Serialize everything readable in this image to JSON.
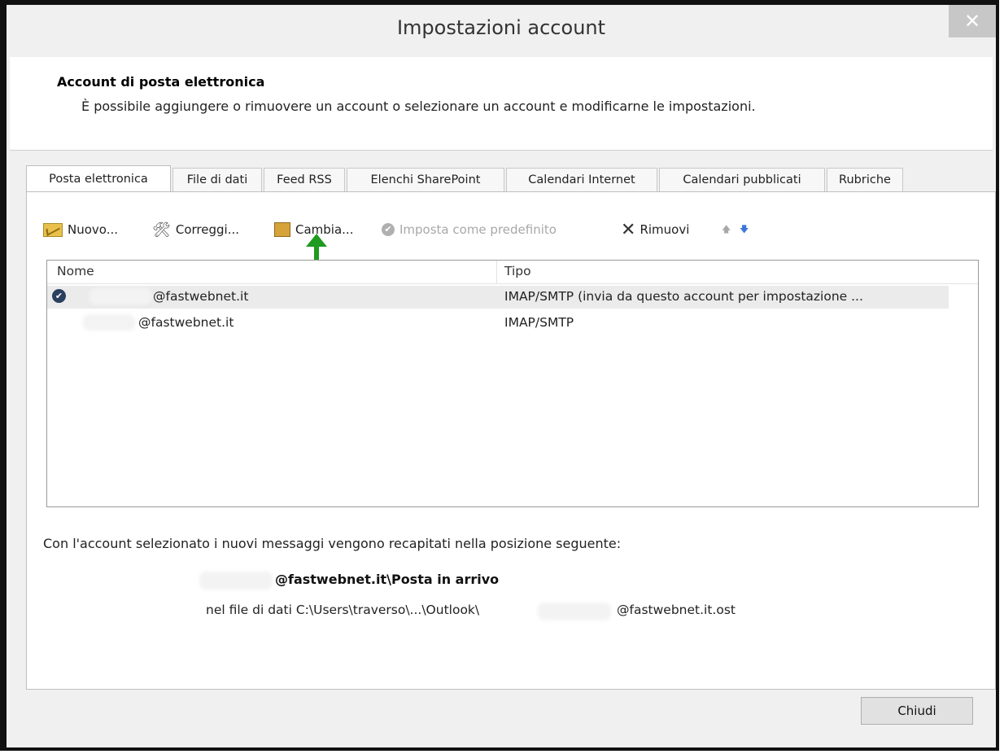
{
  "window": {
    "title": "Impostazioni account",
    "close_glyph": "✕"
  },
  "header": {
    "title": "Account di posta elettronica",
    "description": "È possibile aggiungere o rimuovere un account o selezionare un account e modificarne le impostazioni."
  },
  "tabs": [
    {
      "label": "Posta elettronica",
      "active": true
    },
    {
      "label": "File di dati"
    },
    {
      "label": "Feed RSS"
    },
    {
      "label": "Elenchi SharePoint"
    },
    {
      "label": "Calendari Internet"
    },
    {
      "label": "Calendari pubblicati"
    },
    {
      "label": "Rubriche"
    }
  ],
  "toolbar": {
    "new_label": "Nuovo...",
    "repair_label": "Correggi...",
    "change_label": "Cambia...",
    "set_default_label": "Imposta come predefinito",
    "remove_label": "Rimuovi",
    "up_glyph": "🡅",
    "down_glyph": "🡇"
  },
  "accounts": {
    "columns": {
      "name": "Nome",
      "type": "Tipo"
    },
    "rows": [
      {
        "name": "@fastwebnet.it",
        "type": "IMAP/SMTP (invia da questo account per impostazione ...",
        "default": true
      },
      {
        "name": "@fastwebnet.it",
        "type": "IMAP/SMTP",
        "default": false
      }
    ]
  },
  "delivery": {
    "info": "Con l'account selezionato i nuovi messaggi vengono recapitati nella posizione seguente:",
    "mailbox": "@fastwebnet.it\\Posta in arrivo",
    "file_prefix": "nel file di dati C:\\Users\\traverso\\...\\Outlook\\",
    "file_suffix": "@fastwebnet.it.ost"
  },
  "footer": {
    "close_label": "Chiudi"
  },
  "colors": {
    "annotation_arrow": "#1f9b1f",
    "selected_row": "#ebebeb",
    "default_badge": "#2b3f5f"
  }
}
